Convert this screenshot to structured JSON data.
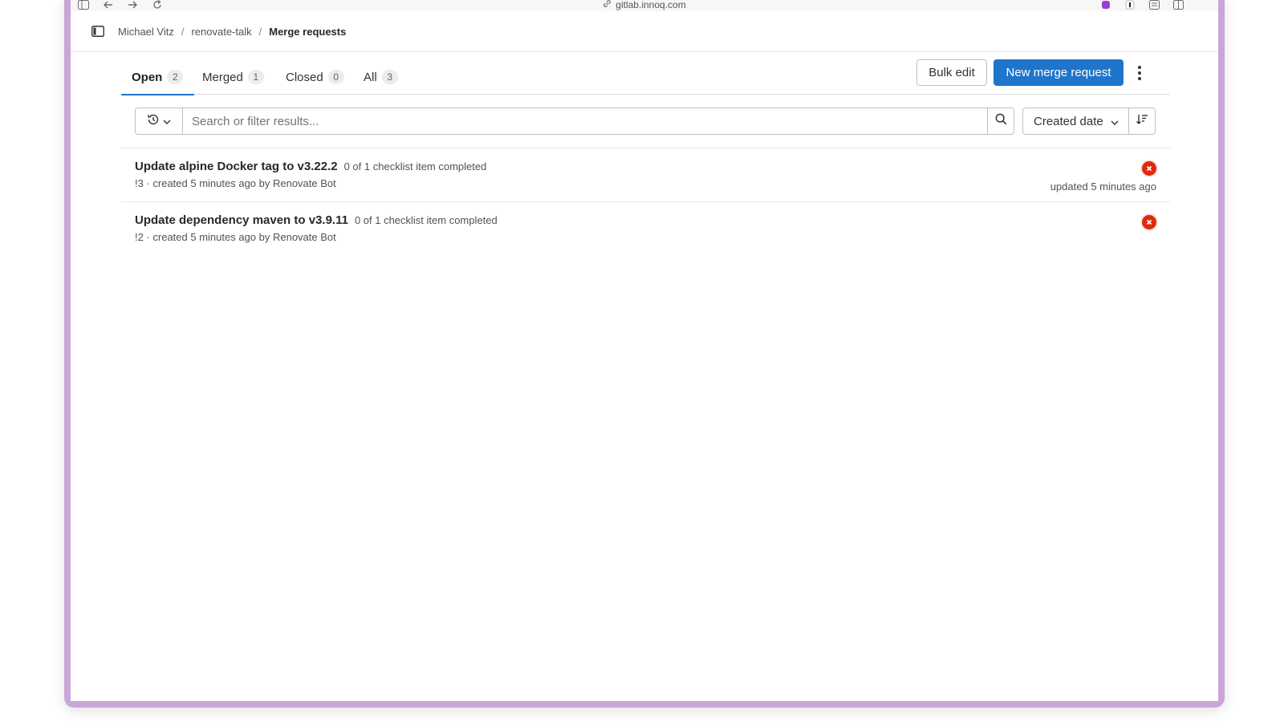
{
  "browser": {
    "url": "gitlab.innoq.com"
  },
  "breadcrumb": {
    "items": [
      "Michael Vitz",
      "renovate-talk"
    ],
    "current": "Merge requests",
    "separator": "/"
  },
  "tabs": [
    {
      "label": "Open",
      "count": "2",
      "active": true
    },
    {
      "label": "Merged",
      "count": "1",
      "active": false
    },
    {
      "label": "Closed",
      "count": "0",
      "active": false
    },
    {
      "label": "All",
      "count": "3",
      "active": false
    }
  ],
  "actions": {
    "bulk_edit": "Bulk edit",
    "new_mr": "New merge request"
  },
  "filter": {
    "placeholder": "Search or filter results...",
    "sort_label": "Created date"
  },
  "merge_requests": [
    {
      "title": "Update alpine Docker tag to v3.22.2",
      "checklist": "0 of 1 checklist item completed",
      "meta": "!3 · created 5 minutes ago by Renovate Bot",
      "updated": "updated 5 minutes ago"
    },
    {
      "title": "Update dependency maven to v3.9.11",
      "checklist": "0 of 1 checklist item completed",
      "meta": "!2 · created 5 minutes ago by Renovate Bot",
      "updated": ""
    }
  ],
  "colors": {
    "primary": "#1f75cb",
    "status_failed": "#dd2b0e",
    "window_frame": "#c9a6d8"
  }
}
